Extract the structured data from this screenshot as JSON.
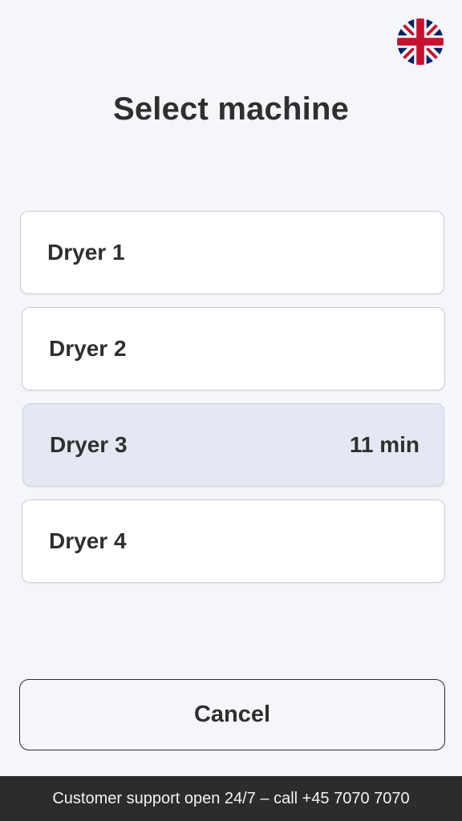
{
  "header": {
    "title": "Select machine",
    "language_icon": "uk-flag-icon"
  },
  "machines": [
    {
      "name": "Dryer 1",
      "status": ""
    },
    {
      "name": "Dryer 2",
      "status": ""
    },
    {
      "name": "Dryer 3",
      "status": "11 min"
    },
    {
      "name": "Dryer 4",
      "status": ""
    }
  ],
  "actions": {
    "cancel_label": "Cancel"
  },
  "footer": {
    "support_text": "Customer support open 24/7 – call +45 7070 7070"
  },
  "colors": {
    "background": "#f4f6fa",
    "busy_item_background": "#e3e8f2",
    "footer_background": "#2c2c2c",
    "flag_blue": "#012169",
    "flag_red": "#C8102E"
  }
}
